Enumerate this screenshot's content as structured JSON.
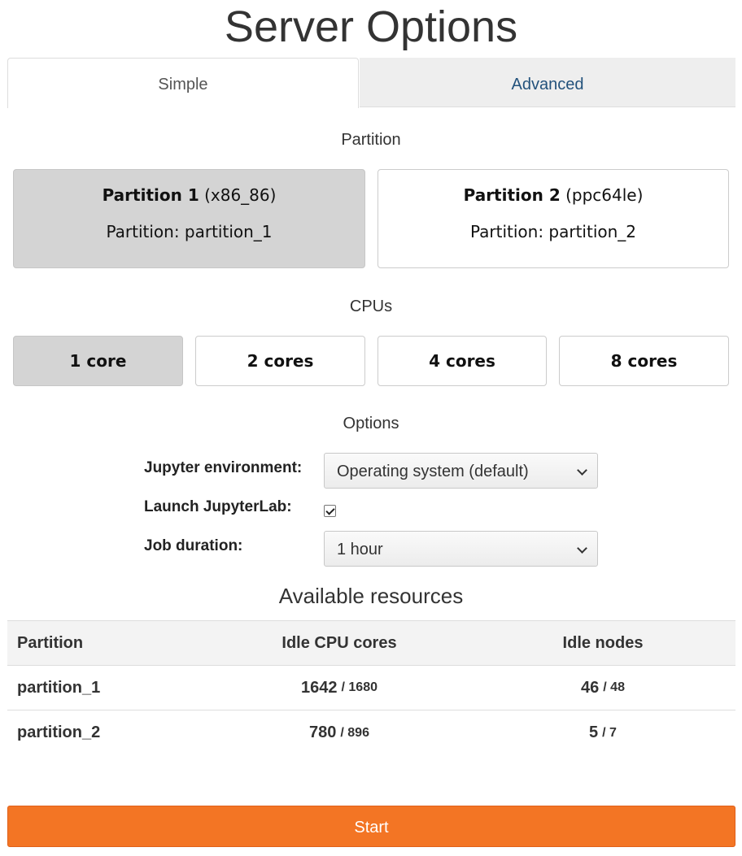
{
  "page": {
    "title": "Server Options"
  },
  "tabs": [
    {
      "label": "Simple",
      "active": true
    },
    {
      "label": "Advanced",
      "active": false
    }
  ],
  "partition_section": {
    "heading": "Partition",
    "cards": [
      {
        "name": "Partition 1",
        "arch": "(x86_86)",
        "detail": "Partition: partition_1",
        "selected": true
      },
      {
        "name": "Partition 2",
        "arch": "(ppc64le)",
        "detail": "Partition: partition_2",
        "selected": false
      }
    ]
  },
  "cpu_section": {
    "heading": "CPUs",
    "options": [
      {
        "label": "1 core",
        "selected": true
      },
      {
        "label": "2 cores",
        "selected": false
      },
      {
        "label": "4 cores",
        "selected": false
      },
      {
        "label": "8 cores",
        "selected": false
      }
    ]
  },
  "options_section": {
    "heading": "Options",
    "jupyter_env": {
      "label": "Jupyter environment:",
      "value": "Operating system (default)"
    },
    "launch_lab": {
      "label": "Launch JupyterLab:",
      "checked": true
    },
    "job_duration": {
      "label": "Job duration:",
      "value": "1 hour"
    }
  },
  "resources": {
    "title": "Available resources",
    "columns": [
      "Partition",
      "Idle CPU cores",
      "Idle nodes"
    ],
    "rows": [
      {
        "partition": "partition_1",
        "idle_cpu": "1642",
        "total_cpu": "/ 1680",
        "idle_nodes": "46",
        "total_nodes": "/ 48"
      },
      {
        "partition": "partition_2",
        "idle_cpu": "780",
        "total_cpu": "/ 896",
        "idle_nodes": "5",
        "total_nodes": "/ 7"
      }
    ]
  },
  "start_button": {
    "label": "Start"
  },
  "colors": {
    "accent": "#f37524",
    "link": "#23527c",
    "selected": "#d4d4d4"
  }
}
